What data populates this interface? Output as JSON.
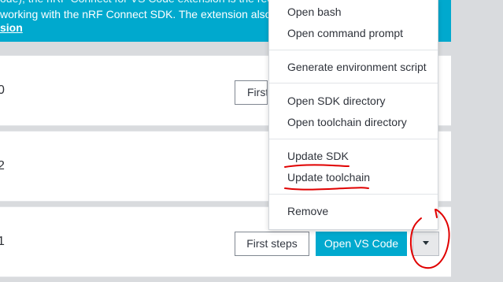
{
  "banner": {
    "line_1": "ode), the nRF Connect for VS Code extension is the recom",
    "line_2": "working with the nRF Connect SDK. The extension also prov",
    "link": "sion"
  },
  "cards": [
    {
      "version": "0",
      "first_steps_label": "First"
    },
    {
      "version": "2"
    },
    {
      "version": "1",
      "first_steps_label": "First steps",
      "open_vscode_label": "Open VS Code"
    }
  ],
  "menu": {
    "items": [
      "Open bash",
      "Open command prompt",
      "Generate environment script",
      "Open SDK directory",
      "Open toolchain directory",
      "Update SDK",
      "Update toolchain",
      "Remove"
    ]
  },
  "annotation": {
    "color": "#e00000"
  },
  "icons": {
    "dropdown": "chevron-down-icon"
  },
  "colors": {
    "brand": "#00a9ce",
    "background": "#d9dbde",
    "card": "#ffffff"
  }
}
